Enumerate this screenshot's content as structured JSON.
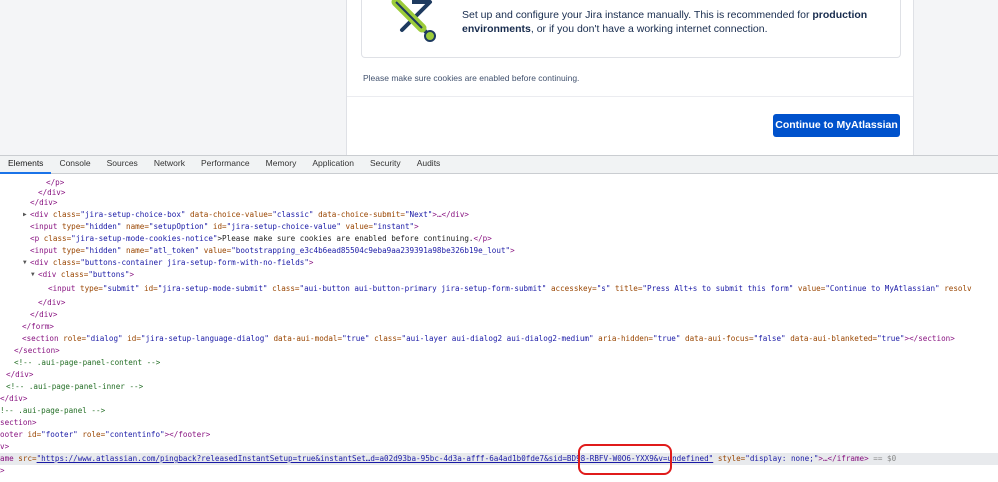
{
  "page": {
    "choice_text_prefix": "Set up and configure your Jira instance manually. This is recommended for",
    "choice_text_bold1": "production",
    "choice_text_bold2": "environments",
    "choice_text_suffix": ", or if you don't have a working internet connection.",
    "cookies_notice": "Please make sure cookies are enabled before continuing.",
    "continue_button": "Continue to MyAtlassian"
  },
  "devtools": {
    "tabs": [
      "Elements",
      "Console",
      "Sources",
      "Network",
      "Performance",
      "Memory",
      "Application",
      "Security",
      "Audits"
    ],
    "active_tab": "Elements",
    "lines": {
      "l0": "</p>",
      "l1": "</div>",
      "l2": "</div>",
      "l3_tag": "<div",
      "l3_a1": "class=",
      "l3_v1": "\"jira-setup-choice-box\"",
      "l3_a2": "data-choice-value=",
      "l3_v2": "\"classic\"",
      "l3_a3": "data-choice-submit=",
      "l3_v3": "\"Next\"",
      "l3_end": ">…</div>",
      "l4_tag": "<input",
      "l4_a1": "type=",
      "l4_v1": "\"hidden\"",
      "l4_a2": "name=",
      "l4_v2": "\"setupOption\"",
      "l4_a3": "id=",
      "l4_v3": "\"jira-setup-choice-value\"",
      "l4_a4": "value=",
      "l4_v4": "\"instant\"",
      "l4_end": ">",
      "l5_tag": "<p",
      "l5_a1": "class=",
      "l5_v1": "\"jira-setup-mode-cookies-notice\"",
      "l5_text": ">Please make sure cookies are enabled before continuing.",
      "l5_end": "</p>",
      "l6_tag": "<input",
      "l6_a1": "type=",
      "l6_v1": "\"hidden\"",
      "l6_a2": "name=",
      "l6_v2": "\"atl_token\"",
      "l6_a3": "value=",
      "l6_v3": "\"bootstrapping_e3c4b6ead85504c9eba9aa239391a98be326b19e_lout\"",
      "l6_end": ">",
      "l7_tag": "<div",
      "l7_a1": "class=",
      "l7_v1": "\"buttons-container jira-setup-form-with-no-fields\"",
      "l7_end": ">",
      "l8_tag": "<div",
      "l8_a1": "class=",
      "l8_v1": "\"buttons\"",
      "l8_end": ">",
      "l9_tag": "<input",
      "l9_a1": "type=",
      "l9_v1": "\"submit\"",
      "l9_a2": "id=",
      "l9_v2": "\"jira-setup-mode-submit\"",
      "l9_a3": "class=",
      "l9_v3": "\"aui-button aui-button-primary jira-setup-form-submit\"",
      "l9_a4": "accesskey=",
      "l9_v4": "\"s\"",
      "l9_a5": "title=",
      "l9_v5": "\"Press Alt+s to submit this form\"",
      "l9_a6": "value=",
      "l9_v6": "\"Continue to MyAtlassian\"",
      "l9_a7": "resolv",
      "l10": "</div>",
      "l11": "</div>",
      "l12": "</form>",
      "l13_tag": "<section",
      "l13_a1": "role=",
      "l13_v1": "\"dialog\"",
      "l13_a2": "id=",
      "l13_v2": "\"jira-setup-language-dialog\"",
      "l13_a3": "data-aui-modal=",
      "l13_v3": "\"true\"",
      "l13_a4": "class=",
      "l13_v4": "\"aui-layer aui-dialog2 aui-dialog2-medium\"",
      "l13_a5": "aria-hidden=",
      "l13_v5": "\"true\"",
      "l13_a6": "data-aui-focus=",
      "l13_v6": "\"false\"",
      "l13_a7": "data-aui-blanketed=",
      "l13_v7": "\"true\"",
      "l13_end": "></section>",
      "l14": "</section>",
      "l15": "<!-- .aui-page-panel-content -->",
      "l16": "</div>",
      "l17": "<!-- .aui-page-panel-inner -->",
      "l18": "</div>",
      "l19": "!-- .aui-page-panel -->",
      "l20": "section>",
      "l21_tag": "ooter",
      "l21_a1": "id=",
      "l21_v1": "\"footer\"",
      "l21_a2": "role=",
      "l21_v2": "\"contentinfo\"",
      "l21_end": "></footer>",
      "l22": "v>",
      "l23_tag": "ame",
      "l23_a1": "src=",
      "l23_v1": "\"https://www.atlassian.com/pingback?releasedInstantSetup=true&instantSet…d=a02d93ba-95bc-4d3a-afff-6a4ad1b0fde7&sid=BD98-RBFV-W0O6-YXX9&v=undefined\"",
      "l23_a2": "style=",
      "l23_v2": "\"display: none;\"",
      "l23_end": ">…</iframe>",
      "l23_sel": "== $0",
      "l24": ">"
    }
  }
}
